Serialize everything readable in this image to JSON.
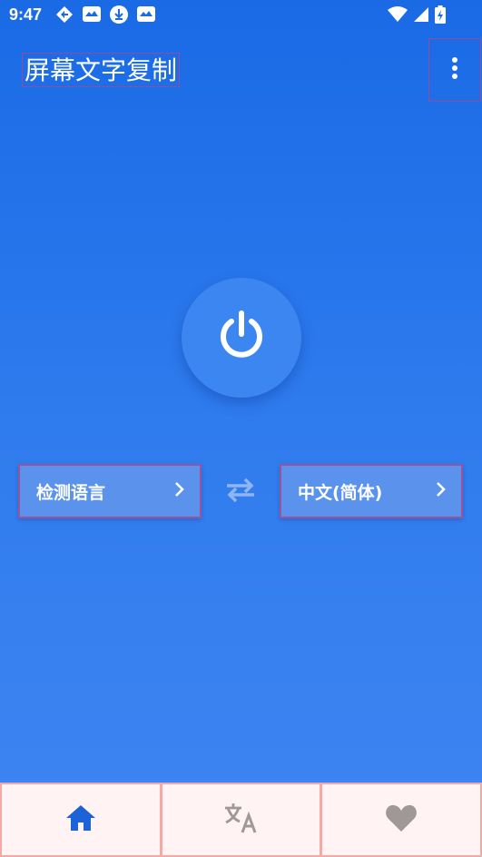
{
  "status_bar": {
    "time": "9:47",
    "left_icons": [
      "navigation-icon",
      "app-notification-icon",
      "download-icon",
      "app-notification-icon"
    ],
    "right_icons": [
      "wifi-icon",
      "signal-icon",
      "battery-charging-icon"
    ]
  },
  "app_bar": {
    "title": "屏幕文字复制",
    "menu_icon": "more-vert-icon"
  },
  "main": {
    "power_icon": "power-icon",
    "source_language": "检测语言",
    "target_language": "中文(简体)",
    "swap_icon": "swap-icon"
  },
  "bottom_nav": {
    "tabs": [
      {
        "icon": "home-icon",
        "active": true
      },
      {
        "icon": "translate-icon",
        "active": false
      },
      {
        "icon": "heart-icon",
        "active": false
      }
    ]
  },
  "colors": {
    "primary": "#1a6ae6",
    "button": "#5b93ec",
    "nav_background": "#fff4f3",
    "active_icon": "#1c63d8",
    "inactive_icon": "#a09896"
  }
}
